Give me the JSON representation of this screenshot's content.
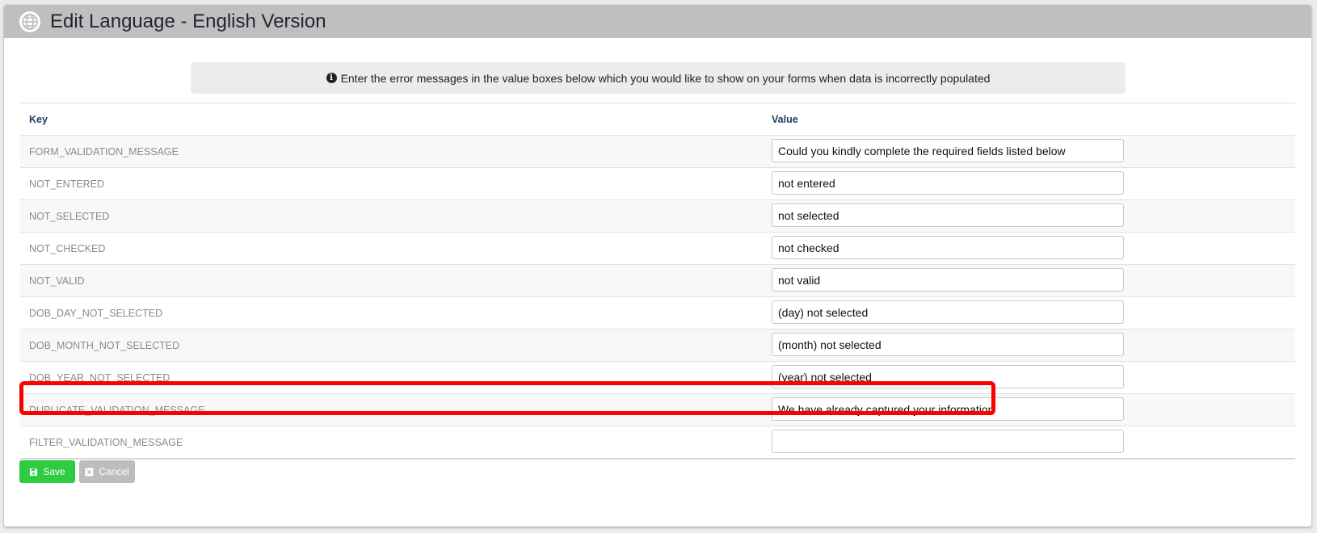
{
  "header": {
    "title": "Edit Language - English Version",
    "icon": "globe-icon"
  },
  "info": {
    "icon": "info-circle-icon",
    "text": "Enter the error messages in the value boxes below which you would like to show on your forms when data is incorrectly populated"
  },
  "table": {
    "columns": [
      "Key",
      "Value"
    ],
    "rows": [
      {
        "key": "FORM_VALIDATION_MESSAGE",
        "value": "Could you kindly complete the required fields listed below"
      },
      {
        "key": "NOT_ENTERED",
        "value": "not entered"
      },
      {
        "key": "NOT_SELECTED",
        "value": "not selected"
      },
      {
        "key": "NOT_CHECKED",
        "value": "not checked"
      },
      {
        "key": "NOT_VALID",
        "value": "not valid"
      },
      {
        "key": "DOB_DAY_NOT_SELECTED",
        "value": "(day) not selected"
      },
      {
        "key": "DOB_MONTH_NOT_SELECTED",
        "value": "(month) not selected"
      },
      {
        "key": "DOB_YEAR_NOT_SELECTED",
        "value": "(year) not selected"
      },
      {
        "key": "DUPLICATE_VALIDATION_MESSAGE",
        "value": "We have already captured your information"
      },
      {
        "key": "FILTER_VALIDATION_MESSAGE",
        "value": ""
      }
    ]
  },
  "buttons": {
    "save": {
      "label": "Save",
      "icon": "floppy-disk-icon"
    },
    "cancel": {
      "label": "Cancel",
      "icon": "close-box-icon"
    }
  },
  "colors": {
    "header_bg": "#bfbfbf",
    "save": "#2ecc40",
    "cancel": "#bdbdbd",
    "highlight": "#ff0000",
    "column_header": "#1c3f66"
  }
}
